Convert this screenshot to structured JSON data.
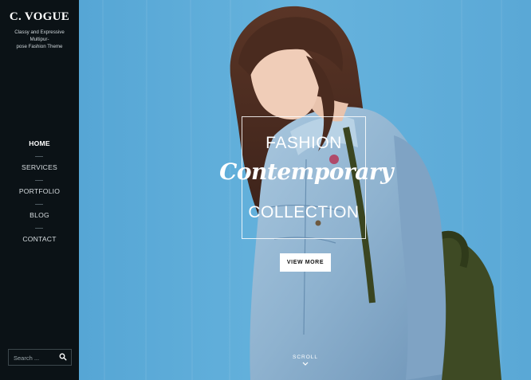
{
  "site": {
    "title": "C. VOGUE",
    "tagline": "Classy and Expressive Multipur-\npose Fashion Theme"
  },
  "nav": {
    "items": [
      {
        "label": "HOME",
        "active": true
      },
      {
        "label": "SERVICES",
        "active": false
      },
      {
        "label": "PORTFOLIO",
        "active": false
      },
      {
        "label": "BLOG",
        "active": false
      },
      {
        "label": "CONTACT",
        "active": false
      }
    ]
  },
  "search": {
    "placeholder": "Search ...",
    "icon": "search-icon"
  },
  "hero": {
    "line1": "FASHION",
    "line2": "Contemporary",
    "line3": "COLLECTION",
    "cta_label": "VIEW MORE",
    "scroll_label": "SCROLL",
    "scroll_icon": "chevron-down-icon",
    "background_color": "#62b0dc"
  },
  "colors": {
    "sidebar_bg": "#0b1216",
    "accent_white": "#ffffff"
  }
}
